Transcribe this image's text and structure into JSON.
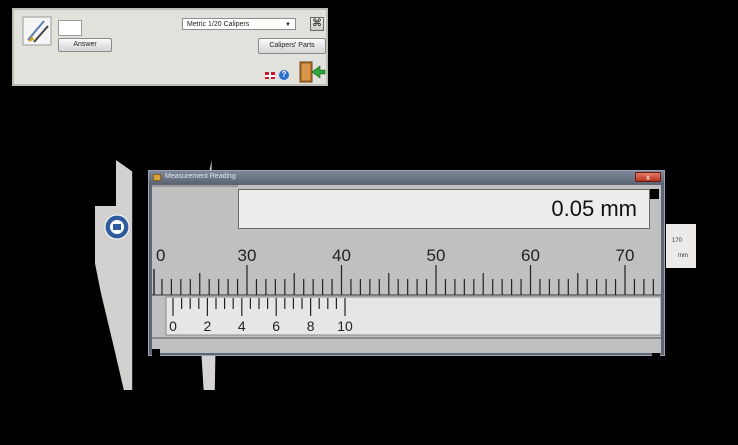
{
  "panel": {
    "answer_label": "Answer",
    "answer_value": "",
    "caliper_type": "Metric 1/20 Calipers",
    "caliper_parts_label": "Calipers' Parts",
    "close_glyph": "⌘",
    "help_glyph": "?"
  },
  "window": {
    "title": "Measurement Reading",
    "close_glyph": "x",
    "reading": "0.05 mm"
  },
  "beam_end": {
    "value": "170",
    "unit": "mm"
  },
  "scale": {
    "main_labels": [
      "0",
      "30",
      "40",
      "50",
      "60",
      "70"
    ],
    "vernier_labels": [
      "0",
      "2",
      "4",
      "6",
      "8",
      "10"
    ]
  },
  "colors": {
    "background": "#000000",
    "panel": "#e2e2dc",
    "window_frame": "#5d6674",
    "scale_face": "#c0c0c0",
    "reading_face": "#ededed"
  },
  "icons": [
    "caliper-tool-icon",
    "flag-uk-icon",
    "help-icon",
    "exit-door-icon",
    "logo-icon"
  ]
}
